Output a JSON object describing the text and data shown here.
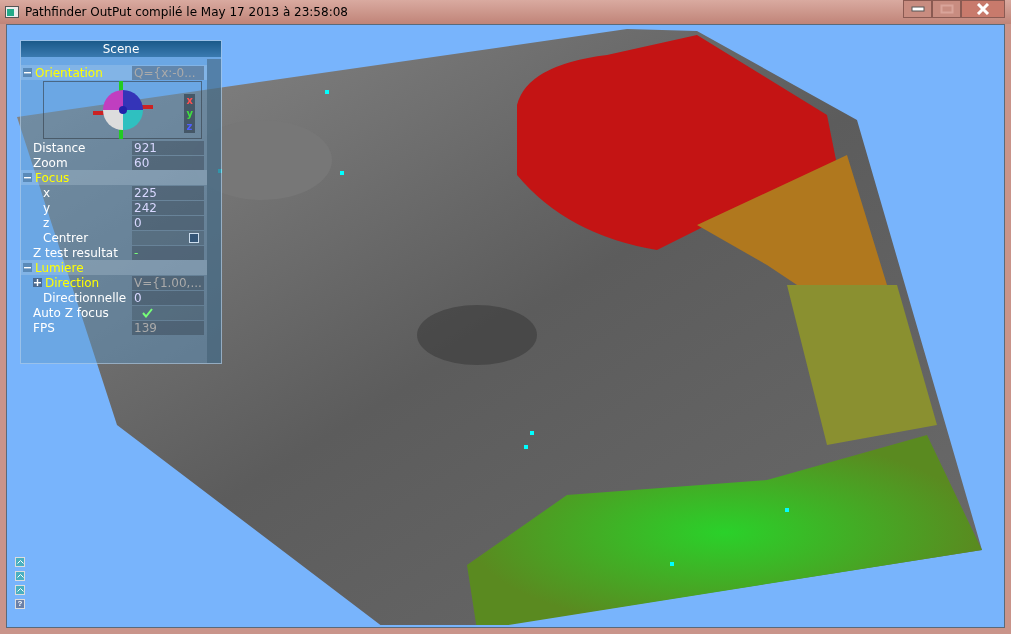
{
  "window": {
    "title": "Pathfinder OutPut compilé le May 17 2013 à 23:58:08"
  },
  "panel": {
    "title": "Scene",
    "rows": [
      {
        "kind": "group",
        "label": "Orientation",
        "expanded": true,
        "value": "Q={x:-0...",
        "children": [
          {
            "kind": "rotation",
            "axes": [
              "x",
              "y",
              "z"
            ]
          }
        ]
      },
      {
        "kind": "value",
        "label": "Distance",
        "value": "921",
        "readonly": false
      },
      {
        "kind": "value",
        "label": "Zoom",
        "value": "60",
        "readonly": false
      },
      {
        "kind": "group",
        "label": "Focus",
        "expanded": true,
        "children": [
          {
            "kind": "value",
            "label": "x",
            "value": "225",
            "readonly": false
          },
          {
            "kind": "value",
            "label": "y",
            "value": "242",
            "readonly": false
          },
          {
            "kind": "value",
            "label": "z",
            "value": "0",
            "readonly": false
          },
          {
            "kind": "checkbox",
            "label": "Centrer",
            "checked": false
          }
        ]
      },
      {
        "kind": "status",
        "label": "Z test resultat",
        "value": "-"
      },
      {
        "kind": "group",
        "label": "Lumiere",
        "expanded": true,
        "children": [
          {
            "kind": "subgroup",
            "label": "Direction",
            "expanded": false,
            "value": "V={1.00,..."
          },
          {
            "kind": "value",
            "label": "Directionnelle",
            "value": "0",
            "readonly": false
          }
        ]
      },
      {
        "kind": "toggle",
        "label": "Auto Z focus",
        "checked": true
      },
      {
        "kind": "value",
        "label": "FPS",
        "value": "139",
        "readonly": true
      }
    ]
  },
  "bar_buttons": [
    {
      "kind": "bar"
    },
    {
      "kind": "bar"
    },
    {
      "kind": "bar"
    },
    {
      "kind": "help",
      "label": "?"
    }
  ]
}
